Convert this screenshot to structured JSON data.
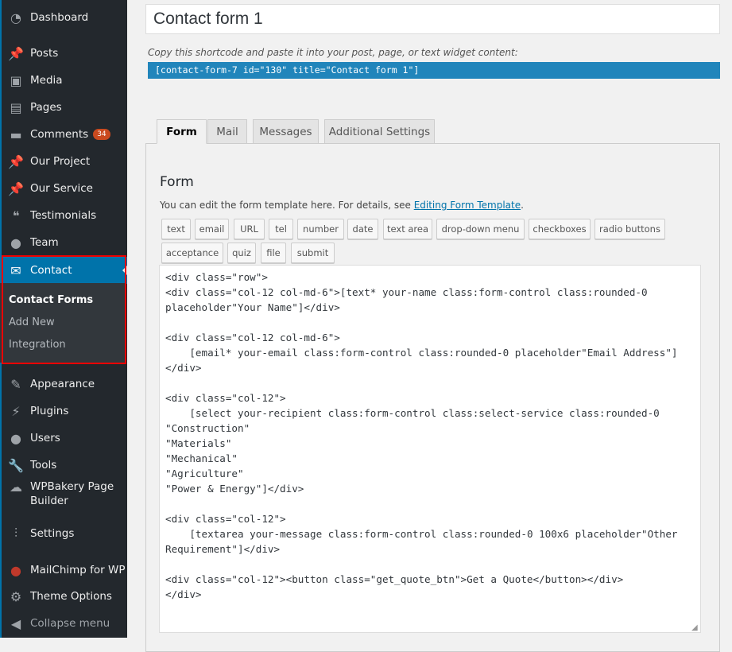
{
  "sidebar": {
    "items": [
      {
        "label": "Dashboard",
        "icon": "dashboard-icon"
      },
      {
        "label": "Posts",
        "icon": "pin-icon"
      },
      {
        "label": "Media",
        "icon": "media-icon"
      },
      {
        "label": "Pages",
        "icon": "pages-icon"
      },
      {
        "label": "Comments",
        "icon": "comment-icon",
        "badge": "34"
      },
      {
        "label": "Our Project",
        "icon": "pin-icon"
      },
      {
        "label": "Our Service",
        "icon": "pin-icon"
      },
      {
        "label": "Testimonials",
        "icon": "quote-icon"
      },
      {
        "label": "Team",
        "icon": "user-icon"
      },
      {
        "label": "Contact",
        "icon": "mail-icon"
      },
      {
        "label": "Appearance",
        "icon": "brush-icon"
      },
      {
        "label": "Plugins",
        "icon": "plug-icon"
      },
      {
        "label": "Users",
        "icon": "users-icon"
      },
      {
        "label": "Tools",
        "icon": "wrench-icon"
      },
      {
        "label": "WPBakery Page Builder",
        "icon": "cloud-icon"
      },
      {
        "label": "Settings",
        "icon": "sliders-icon"
      },
      {
        "label": "MailChimp for WP",
        "icon": "mailchimp-icon"
      },
      {
        "label": "Theme Options",
        "icon": "gear-icon"
      },
      {
        "label": "Collapse menu",
        "icon": "collapse-icon"
      }
    ],
    "submenu": [
      "Contact Forms",
      "Add New",
      "Integration"
    ]
  },
  "main": {
    "title": "Contact form 1",
    "hint": "Copy this shortcode and paste it into your post, page, or text widget content:",
    "shortcode": "[contact-form-7 id=\"130\" title=\"Contact form 1\"]",
    "tabs": [
      "Form",
      "Mail",
      "Messages",
      "Additional Settings"
    ],
    "form_heading": "Form",
    "desc": "You can edit the form template here. For details, see ",
    "desc_link": "Editing Form Template",
    "desc_end": ".",
    "tag_buttons": [
      "text",
      "email",
      "URL",
      "tel",
      "number",
      "date",
      "text area",
      "drop-down menu",
      "checkboxes",
      "radio buttons",
      "acceptance",
      "quiz",
      "file",
      "submit"
    ],
    "code": "<div class=\"row\">\n<div class=\"col-12 col-md-6\">[text* your-name class:form-control class:rounded-0 placeholder\"Your Name\"]</div>\n\n<div class=\"col-12 col-md-6\">\n    [email* your-email class:form-control class:rounded-0 placeholder\"Email Address\"]\n</div>\n\n<div class=\"col-12\">\n    [select your-recipient class:form-control class:select-service class:rounded-0\n\"Construction\"\n\"Materials\"\n\"Mechanical\"\n\"Agriculture\"\n\"Power & Energy\"]</div>\n\n<div class=\"col-12\">\n    [textarea your-message class:form-control class:rounded-0 100x6 placeholder\"Other Requirement\"]</div>\n\n<div class=\"col-12\"><button class=\"get_quote_btn\">Get a Quote</button></div>\n</div>"
  }
}
